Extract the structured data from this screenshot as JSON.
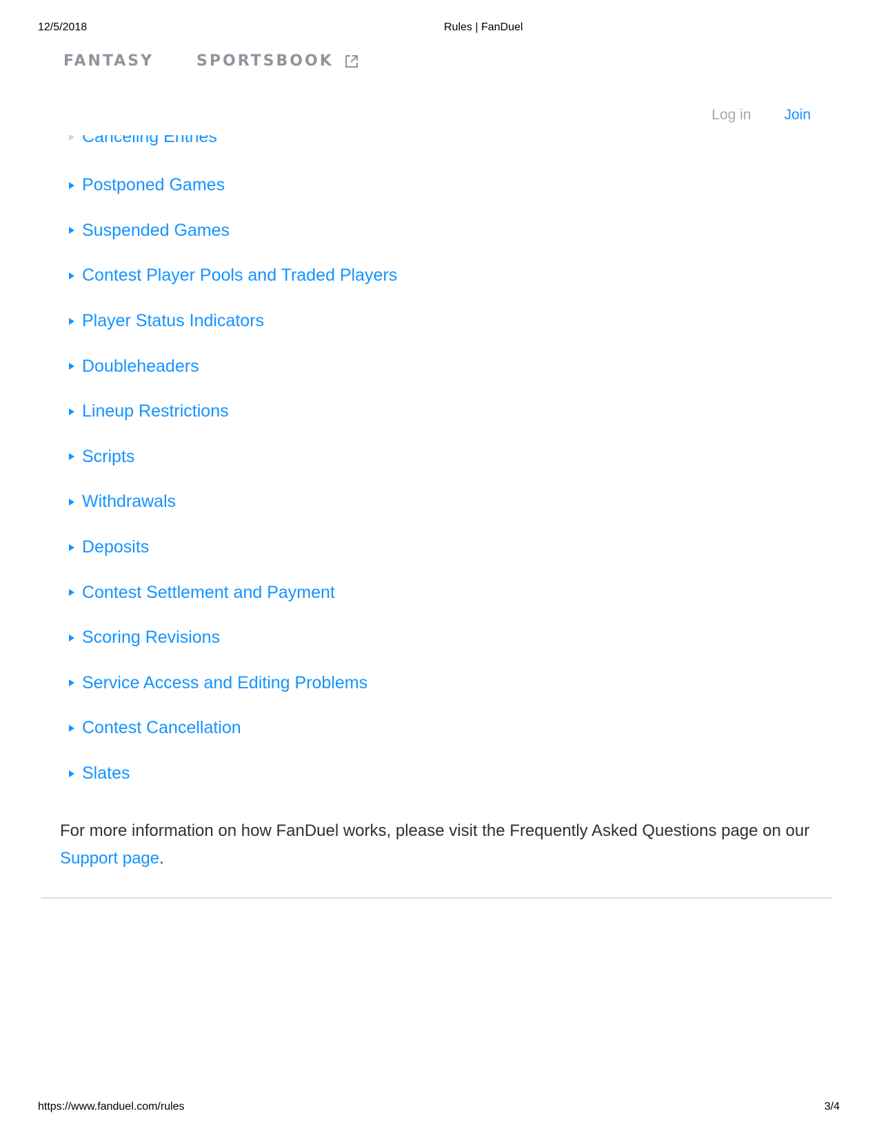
{
  "print_header": {
    "date": "12/5/2018",
    "title": "Rules | FanDuel"
  },
  "nav": {
    "fantasy": "FANTASY",
    "sportsbook": "SPORTSBOOK",
    "sportsbook_icon": "external-link-icon"
  },
  "auth": {
    "login": "Log in",
    "join": "Join"
  },
  "rules": {
    "partial_item": "Canceling Entries",
    "items": [
      {
        "label": "Postponed Games"
      },
      {
        "label": "Suspended Games"
      },
      {
        "label": "Contest Player Pools and Traded Players"
      },
      {
        "label": "Player Status Indicators"
      },
      {
        "label": "Doubleheaders"
      },
      {
        "label": "Lineup Restrictions"
      },
      {
        "label": "Scripts"
      },
      {
        "label": "Withdrawals"
      },
      {
        "label": "Deposits"
      },
      {
        "label": "Contest Settlement and Payment"
      },
      {
        "label": "Scoring Revisions"
      },
      {
        "label": "Service Access and Editing Problems"
      },
      {
        "label": "Contest Cancellation"
      },
      {
        "label": "Slates"
      }
    ]
  },
  "info": {
    "text_before": "For more information on how FanDuel works, please visit the Frequently Asked Questions page on our ",
    "link": "Support page",
    "text_after": "."
  },
  "print_footer": {
    "url": "https://www.fanduel.com/rules",
    "page": "3/4"
  },
  "colors": {
    "link": "#1493ff",
    "nav": "#8f959c",
    "body_text": "#2c3138"
  }
}
